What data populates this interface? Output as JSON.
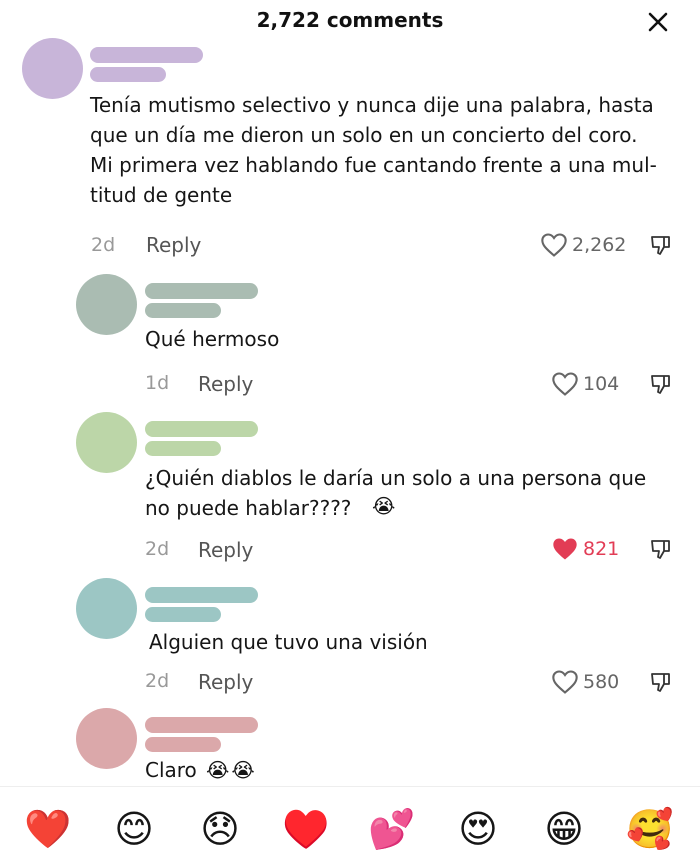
{
  "header": {
    "title": "2,722 comments"
  },
  "comments": [
    {
      "avatar_color": "#c8b5d9",
      "bar_color": "#c8b5d9",
      "text": "Tenía mutismo selectivo y nunca dije una palabra, hasta\nque un día me dieron un solo en un concierto del coro.\nMi primera vez hablando fue cantando frente a una mul-\ntitud de gente",
      "time": "2d",
      "reply_label": "Reply",
      "likes": "2,262",
      "liked": false
    },
    {
      "avatar_color": "#aabcb2",
      "bar_color": "#aabcb2",
      "text": "Qué hermoso",
      "time": "1d",
      "reply_label": "Reply",
      "likes": "104",
      "liked": false
    },
    {
      "avatar_color": "#bcd6a8",
      "bar_color": "#bcd6a8",
      "text": "¿Quién diablos le daría un solo a una persona que\nno puede hablar????",
      "emoji": "😭",
      "time": "2d",
      "reply_label": "Reply",
      "likes": "821",
      "liked": true
    },
    {
      "avatar_color": "#9cc6c4",
      "bar_color": "#9cc6c4",
      "text": "Alguien que tuvo una visión",
      "time": "2d",
      "reply_label": "Reply",
      "likes": "580",
      "liked": false
    },
    {
      "avatar_color": "#dba8aa",
      "bar_color": "#dba8aa",
      "text": "Claro",
      "emoji": "😭😭"
    }
  ],
  "reactions": [
    "❤️",
    "😊",
    "😞",
    "♥️",
    "💕",
    "😍",
    "😁",
    "🥰"
  ],
  "colors": {
    "like_active": "#e23c55",
    "text_muted": "#999999"
  }
}
